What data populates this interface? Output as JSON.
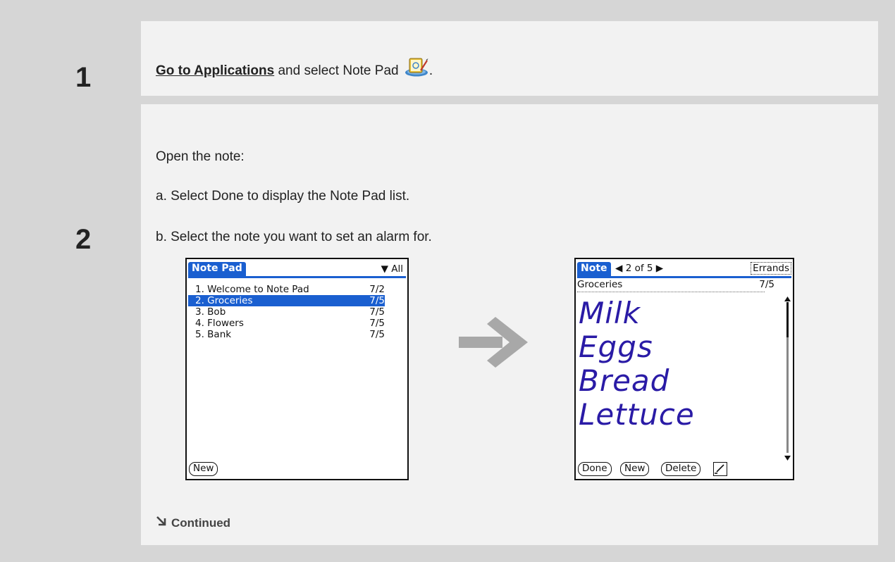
{
  "steps": {
    "one": {
      "number": "1",
      "link_text": "Go to Applications",
      "text_after": " and select Note Pad ",
      "text_end": "."
    },
    "two": {
      "number": "2",
      "intro": "Open the note:",
      "sub_a": "a.  Select Done to display the Note Pad list.",
      "sub_b": "b.  Select the note you want to set an alarm for.",
      "continued": "Continued"
    }
  },
  "screen_list": {
    "title": "Note Pad",
    "category": "All",
    "rows": [
      {
        "label": "1. Welcome to Note Pad",
        "date": "7/2"
      },
      {
        "label": "2. Groceries",
        "date": "7/5"
      },
      {
        "label": "3. Bob",
        "date": "7/5"
      },
      {
        "label": "4. Flowers",
        "date": "7/5"
      },
      {
        "label": "5. Bank",
        "date": "7/5"
      }
    ],
    "selected_index": 1,
    "new_button": "New"
  },
  "screen_note": {
    "title": "Note",
    "pager": "2 of 5",
    "category": "Errands",
    "note_title": "Groceries",
    "note_date": "7/5",
    "handwritten_lines": [
      "Milk",
      "Eggs",
      "Bread",
      "Lettuce"
    ],
    "buttons": {
      "done": "Done",
      "new": "New",
      "delete": "Delete"
    }
  },
  "colors": {
    "palm_blue": "#1a5fd0",
    "ink": "#2a1ba6",
    "page_bg": "#d6d6d6",
    "panel_bg": "#f2f2f2",
    "arrow": "#a8a8a8"
  },
  "icons": {
    "notepad": "notepad-app-icon",
    "arrow": "right-arrow-icon",
    "continued": "continued-arrow-icon"
  }
}
